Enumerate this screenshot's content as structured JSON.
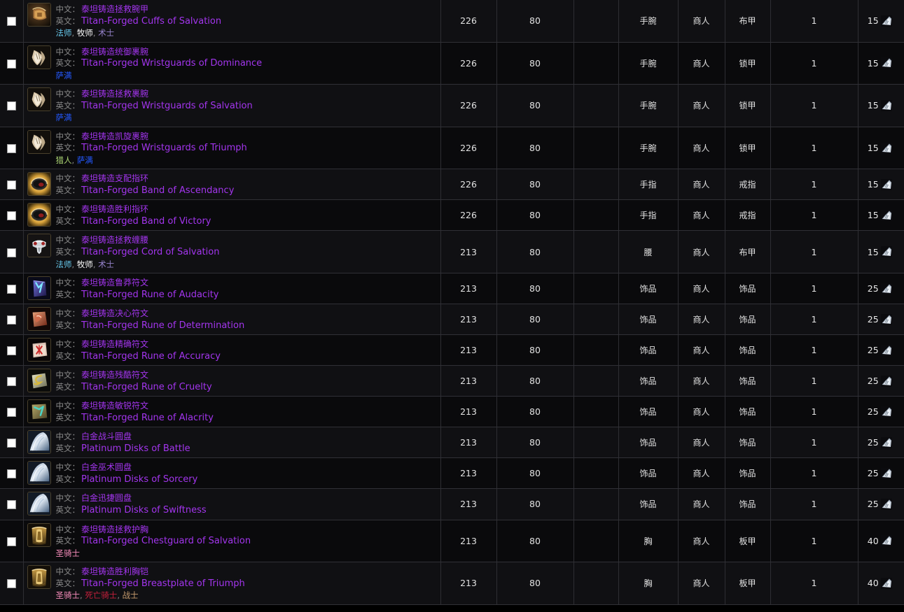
{
  "meta": {
    "label_zh": "中文：",
    "label_en": "英文：",
    "class_separator": ", "
  },
  "class_colors": {
    "法师": "#69ccf0",
    "牧师": "#ffffff",
    "术士": "#9482c9",
    "萨满": "#2459ff",
    "猎人": "#abd473",
    "圣骑士": "#f58cba",
    "死亡骑士": "#c41f3b",
    "战士": "#c79c6e"
  },
  "item_quality_color": "#a335ee",
  "rows": [
    {
      "checked": false,
      "name_zh": "泰坦铸造拯救腕甲",
      "name_en": "Titan-Forged Cuffs of Salvation",
      "classes": [
        "法师",
        "牧师",
        "术士"
      ],
      "ilvl": "226",
      "req_level": "80",
      "blank": "",
      "slot": "手腕",
      "source": "商人",
      "armor": "布甲",
      "qty": "1",
      "cost": "15",
      "icon": "bracer-cloth-icon"
    },
    {
      "checked": false,
      "name_zh": "泰坦铸造统御裹腕",
      "name_en": "Titan-Forged Wristguards of Dominance",
      "classes": [
        "萨满"
      ],
      "ilvl": "226",
      "req_level": "80",
      "blank": "",
      "slot": "手腕",
      "source": "商人",
      "armor": "锁甲",
      "qty": "1",
      "cost": "15",
      "icon": "bracer-mail-icon"
    },
    {
      "checked": false,
      "name_zh": "泰坦铸造拯救裹腕",
      "name_en": "Titan-Forged Wristguards of Salvation",
      "classes": [
        "萨满"
      ],
      "ilvl": "226",
      "req_level": "80",
      "blank": "",
      "slot": "手腕",
      "source": "商人",
      "armor": "锁甲",
      "qty": "1",
      "cost": "15",
      "icon": "bracer-mail-icon"
    },
    {
      "checked": false,
      "name_zh": "泰坦铸造凯旋裹腕",
      "name_en": "Titan-Forged Wristguards of Triumph",
      "classes": [
        "猎人",
        "萨满"
      ],
      "ilvl": "226",
      "req_level": "80",
      "blank": "",
      "slot": "手腕",
      "source": "商人",
      "armor": "锁甲",
      "qty": "1",
      "cost": "15",
      "icon": "bracer-mail-icon"
    },
    {
      "checked": false,
      "name_zh": "泰坦铸造支配指环",
      "name_en": "Titan-Forged Band of Ascendancy",
      "classes": [],
      "ilvl": "226",
      "req_level": "80",
      "blank": "",
      "slot": "手指",
      "source": "商人",
      "armor": "戒指",
      "qty": "1",
      "cost": "15",
      "icon": "ring-icon"
    },
    {
      "checked": false,
      "name_zh": "泰坦铸造胜利指环",
      "name_en": "Titan-Forged Band of Victory",
      "classes": [],
      "ilvl": "226",
      "req_level": "80",
      "blank": "",
      "slot": "手指",
      "source": "商人",
      "armor": "戒指",
      "qty": "1",
      "cost": "15",
      "icon": "ring-icon"
    },
    {
      "checked": false,
      "name_zh": "泰坦铸造拯救缠腰",
      "name_en": "Titan-Forged Cord of Salvation",
      "classes": [
        "法师",
        "牧师",
        "术士"
      ],
      "ilvl": "213",
      "req_level": "80",
      "blank": "",
      "slot": "腰",
      "source": "商人",
      "armor": "布甲",
      "qty": "1",
      "cost": "15",
      "icon": "belt-cloth-icon"
    },
    {
      "checked": false,
      "name_zh": "泰坦铸造鲁莽符文",
      "name_en": "Titan-Forged Rune of Audacity",
      "classes": [],
      "ilvl": "213",
      "req_level": "80",
      "blank": "",
      "slot": "饰品",
      "source": "商人",
      "armor": "饰品",
      "qty": "1",
      "cost": "25",
      "icon": "rune-blue-icon"
    },
    {
      "checked": false,
      "name_zh": "泰坦铸造决心符文",
      "name_en": "Titan-Forged Rune of Determination",
      "classes": [],
      "ilvl": "213",
      "req_level": "80",
      "blank": "",
      "slot": "饰品",
      "source": "商人",
      "armor": "饰品",
      "qty": "1",
      "cost": "25",
      "icon": "rune-red-icon"
    },
    {
      "checked": false,
      "name_zh": "泰坦铸造精确符文",
      "name_en": "Titan-Forged Rune of Accuracy",
      "classes": [],
      "ilvl": "213",
      "req_level": "80",
      "blank": "",
      "slot": "饰品",
      "source": "商人",
      "armor": "饰品",
      "qty": "1",
      "cost": "25",
      "icon": "rune-pink-icon"
    },
    {
      "checked": false,
      "name_zh": "泰坦铸造残酷符文",
      "name_en": "Titan-Forged Rune of Cruelty",
      "classes": [],
      "ilvl": "213",
      "req_level": "80",
      "blank": "",
      "slot": "饰品",
      "source": "商人",
      "armor": "饰品",
      "qty": "1",
      "cost": "25",
      "icon": "rune-yellow-icon"
    },
    {
      "checked": false,
      "name_zh": "泰坦铸造敏锐符文",
      "name_en": "Titan-Forged Rune of Alacrity",
      "classes": [],
      "ilvl": "213",
      "req_level": "80",
      "blank": "",
      "slot": "饰品",
      "source": "商人",
      "armor": "饰品",
      "qty": "1",
      "cost": "25",
      "icon": "rune-teal-icon"
    },
    {
      "checked": false,
      "name_zh": "白金战斗圆盘",
      "name_en": "Platinum Disks of Battle",
      "classes": [],
      "ilvl": "213",
      "req_level": "80",
      "blank": "",
      "slot": "饰品",
      "source": "商人",
      "armor": "饰品",
      "qty": "1",
      "cost": "25",
      "icon": "disk-icon"
    },
    {
      "checked": false,
      "name_zh": "白金巫术圆盘",
      "name_en": "Platinum Disks of Sorcery",
      "classes": [],
      "ilvl": "213",
      "req_level": "80",
      "blank": "",
      "slot": "饰品",
      "source": "商人",
      "armor": "饰品",
      "qty": "1",
      "cost": "25",
      "icon": "disk-icon"
    },
    {
      "checked": false,
      "name_zh": "白金迅捷圆盘",
      "name_en": "Platinum Disks of Swiftness",
      "classes": [],
      "ilvl": "213",
      "req_level": "80",
      "blank": "",
      "slot": "饰品",
      "source": "商人",
      "armor": "饰品",
      "qty": "1",
      "cost": "25",
      "icon": "disk-icon"
    },
    {
      "checked": false,
      "name_zh": "泰坦铸造拯救护胸",
      "name_en": "Titan-Forged Chestguard of Salvation",
      "classes": [
        "圣骑士"
      ],
      "ilvl": "213",
      "req_level": "80",
      "blank": "",
      "slot": "胸",
      "source": "商人",
      "armor": "板甲",
      "qty": "1",
      "cost": "40",
      "icon": "chest-plate-icon"
    },
    {
      "checked": false,
      "name_zh": "泰坦铸造胜利胸铠",
      "name_en": "Titan-Forged Breastplate of Triumph",
      "classes": [
        "圣骑士",
        "死亡骑士",
        "战士"
      ],
      "ilvl": "213",
      "req_level": "80",
      "blank": "",
      "slot": "胸",
      "source": "商人",
      "armor": "板甲",
      "qty": "1",
      "cost": "40",
      "icon": "chest-plate-icon"
    }
  ]
}
